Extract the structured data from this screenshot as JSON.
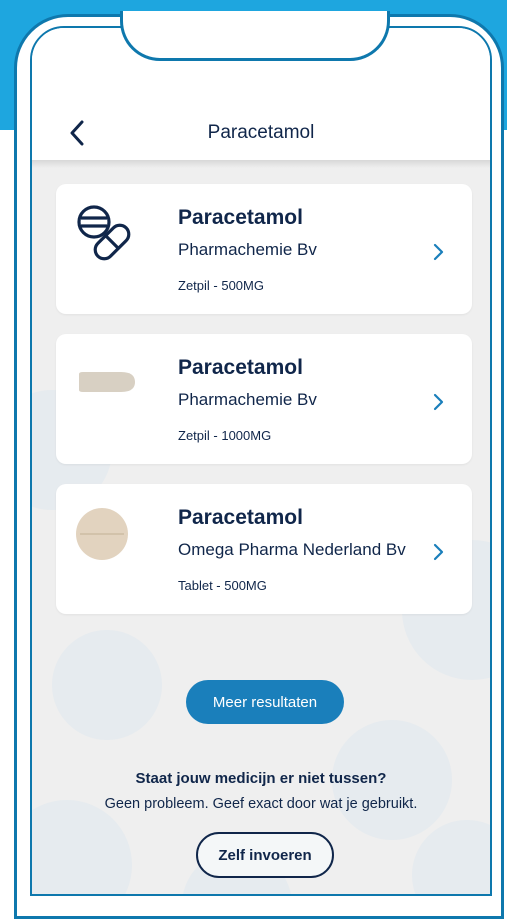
{
  "header": {
    "title": "Paracetamol"
  },
  "results": [
    {
      "name": "Paracetamol",
      "manufacturer": "Pharmachemie Bv",
      "form": "Zetpil - 500MG",
      "image": "pills-icon"
    },
    {
      "name": "Paracetamol",
      "manufacturer": "Pharmachemie Bv",
      "form": "Zetpil - 1000MG",
      "image": "suppository-image"
    },
    {
      "name": "Paracetamol",
      "manufacturer": "Omega Pharma Nederland Bv",
      "form": "Tablet - 500MG",
      "image": "tablet-image"
    }
  ],
  "more_results_label": "Meer resultaten",
  "not_found": {
    "title": "Staat jouw medicijn er niet tussen?",
    "text": "Geen probleem. Geef exact door wat je gebruikt."
  },
  "manual_entry_label": "Zelf invoeren",
  "colors": {
    "accent": "#1a7fbb",
    "band": "#1ea6df",
    "frame": "#0e78ad",
    "text": "#10264a"
  }
}
